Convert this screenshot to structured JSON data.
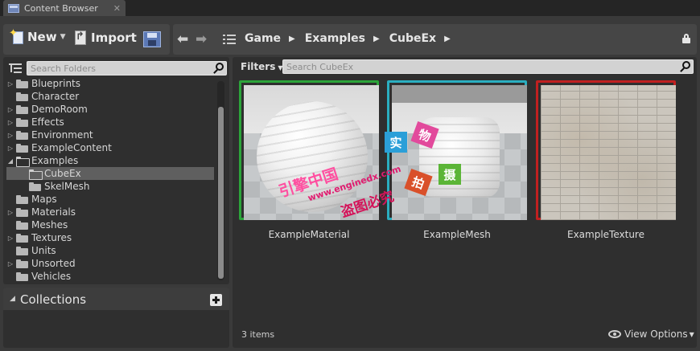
{
  "tab": {
    "label": "Content Browser",
    "close": "✕",
    "icon": "content-browser-icon"
  },
  "toolbar": {
    "new_label": "New",
    "import_label": "Import",
    "new_icon": "new-asset-icon",
    "import_icon": "import-icon",
    "save_icon": "save-all-icon"
  },
  "navigation": {
    "back_icon": "back-arrow-icon",
    "forward_icon": "forward-arrow-icon",
    "history_icon": "path-history-icon",
    "breadcrumbs": [
      "Game",
      "Examples",
      "CubeEx"
    ],
    "lock_icon": "lock-icon"
  },
  "folders": {
    "search_placeholder": "Search Folders",
    "items": [
      {
        "label": "Blueprints",
        "expandable": true,
        "indent": 0
      },
      {
        "label": "Character",
        "expandable": false,
        "indent": 0
      },
      {
        "label": "DemoRoom",
        "expandable": true,
        "indent": 0
      },
      {
        "label": "Effects",
        "expandable": true,
        "indent": 0
      },
      {
        "label": "Environment",
        "expandable": true,
        "indent": 0
      },
      {
        "label": "ExampleContent",
        "expandable": true,
        "indent": 0
      },
      {
        "label": "Examples",
        "expandable": true,
        "expanded": true,
        "indent": 0
      },
      {
        "label": "CubeEx",
        "expandable": false,
        "indent": 1,
        "selected": true
      },
      {
        "label": "SkelMesh",
        "expandable": false,
        "indent": 1
      },
      {
        "label": "Maps",
        "expandable": false,
        "indent": 0
      },
      {
        "label": "Materials",
        "expandable": true,
        "indent": 0
      },
      {
        "label": "Meshes",
        "expandable": false,
        "indent": 0
      },
      {
        "label": "Textures",
        "expandable": true,
        "indent": 0
      },
      {
        "label": "Units",
        "expandable": false,
        "indent": 0
      },
      {
        "label": "Unsorted",
        "expandable": true,
        "indent": 0
      },
      {
        "label": "Vehicles",
        "expandable": false,
        "indent": 0
      }
    ]
  },
  "collections": {
    "title": "Collections",
    "add_icon": "add-collection-icon"
  },
  "assets": {
    "filters_label": "Filters",
    "search_placeholder": "Search CubeEx",
    "items": [
      {
        "name": "ExampleMaterial",
        "type": "material",
        "border_color": "#2ca53a"
      },
      {
        "name": "ExampleMesh",
        "type": "static-mesh",
        "border_color": "#2aaec0"
      },
      {
        "name": "ExampleTexture",
        "type": "texture",
        "border_color": "#c12020"
      }
    ],
    "count_text": "3 items",
    "view_options_label": "View Options"
  },
  "watermark": {
    "boxes": [
      "实",
      "物",
      "拍",
      "摄"
    ],
    "line1": "引擎中国",
    "line2": "www.enginedx.com",
    "line3": "盗图必究"
  },
  "colors": {
    "panel": "#2f2f2f",
    "toolbar": "#464646",
    "selected_row": "#5f5f5f"
  }
}
